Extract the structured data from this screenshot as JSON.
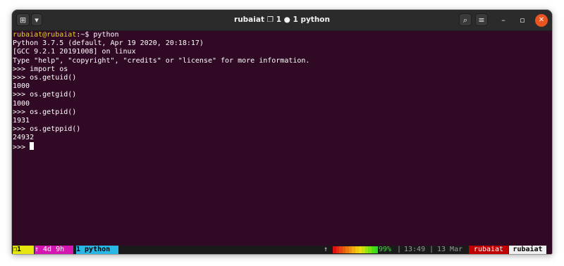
{
  "window": {
    "title": "rubaiat ❐ 1 ● 1 python",
    "newtab_icon": "⊞",
    "menu_icon": "▾",
    "search_icon": "⌕",
    "hamburger_icon": "≡",
    "minimize_icon": "–",
    "maximize_icon": "▫",
    "close_icon": "✕"
  },
  "terminal": {
    "prompt_user": "rubaiat@rubaiat",
    "prompt_suffix": ":~$ python",
    "lines": [
      "Python 3.7.5 (default, Apr 19 2020, 20:18:17)",
      "[GCC 9.2.1 20191008] on linux",
      "Type \"help\", \"copyright\", \"credits\" or \"license\" for more information.",
      ">>> import os",
      ">>> os.getuid()",
      "1000",
      ">>> os.getgid()",
      "1000",
      ">>> os.getpid()",
      "1931",
      ">>> os.getppid()",
      "24932"
    ],
    "final_prompt": ">>>"
  },
  "statusbar": {
    "session": "❐1",
    "uptime": "↑ 4d 9h",
    "window_label": "1 python",
    "up_arrow": "↑",
    "battery_percent": "99%",
    "battery_level": 0.99,
    "separator": "|",
    "time": "13:49",
    "date": "13 Mar",
    "user": "rubaiat",
    "host": "rubaiat"
  },
  "colors": {
    "terminal_bg": "#300a24",
    "titlebar_bg": "#2b2b2b",
    "prompt_user": "#e5d42b",
    "close_button": "#e95420",
    "session_segment": "#e5e510",
    "uptime_segment": "#d616b0",
    "window_segment": "#29b8e6",
    "user_segment": "#c00000",
    "host_segment": "#efefef"
  }
}
